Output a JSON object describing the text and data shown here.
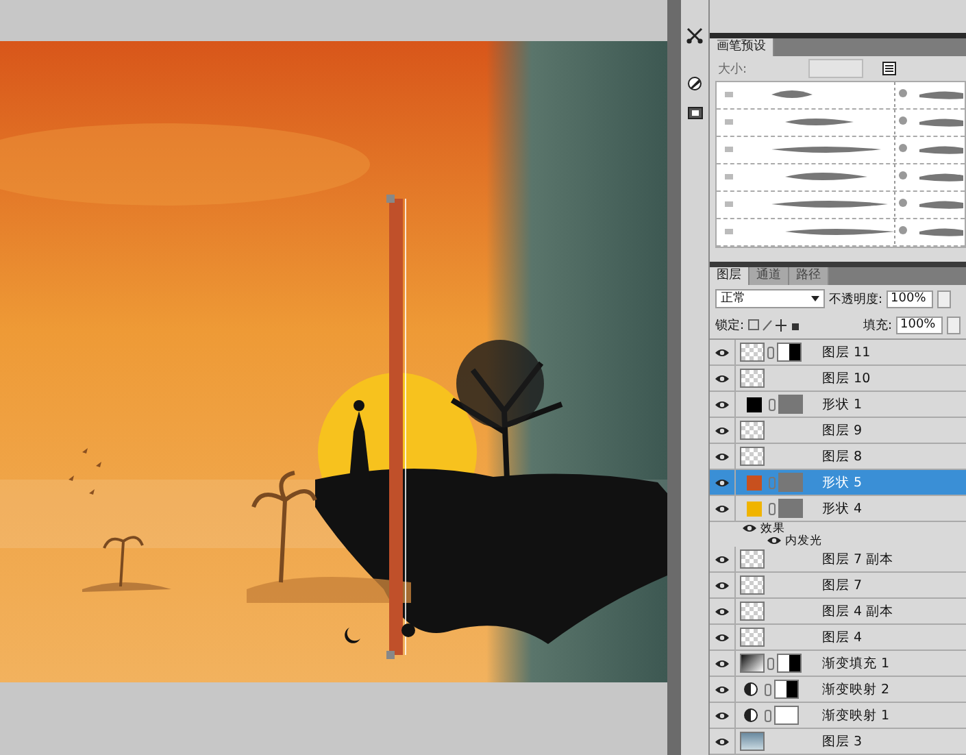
{
  "brush_panel": {
    "tabs": [
      {
        "label": "画笔预设",
        "selected": true
      }
    ],
    "size_label": "大小:"
  },
  "layers_panel": {
    "tabs": [
      {
        "label": "图层",
        "selected": true
      },
      {
        "label": "通道",
        "selected": false
      },
      {
        "label": "路径",
        "selected": false
      }
    ],
    "blend_mode": "正常",
    "opacity_label": "不透明度:",
    "opacity": "100%",
    "lock_label": "锁定:",
    "fill_label": "填充:",
    "fill": "100%",
    "layers": [
      {
        "kind": "layer",
        "name": "图层 11",
        "selected": false,
        "mask": true,
        "mask_has_black": true
      },
      {
        "kind": "layer",
        "name": "图层 10",
        "selected": false
      },
      {
        "kind": "shape",
        "name": "形状 1",
        "selected": false,
        "color": "#000000"
      },
      {
        "kind": "layer",
        "name": "图层 9",
        "selected": false
      },
      {
        "kind": "layer",
        "name": "图层 8",
        "selected": false
      },
      {
        "kind": "shape",
        "name": "形状 5",
        "selected": true,
        "color": "#c8501e"
      },
      {
        "kind": "shape",
        "name": "形状 4",
        "selected": false,
        "color": "#f0b400"
      },
      {
        "kind": "effects",
        "name": "效果",
        "selected": false
      },
      {
        "kind": "effect",
        "name": "内发光",
        "selected": false
      },
      {
        "kind": "layer",
        "name": "图层 7 副本",
        "selected": false
      },
      {
        "kind": "layer",
        "name": "图层 7",
        "selected": false
      },
      {
        "kind": "layer",
        "name": "图层 4 副本",
        "selected": false
      },
      {
        "kind": "layer",
        "name": "图层 4",
        "selected": false
      },
      {
        "kind": "fill",
        "name": "渐变填充 1",
        "selected": false,
        "mask": true,
        "mask_has_black": true
      },
      {
        "kind": "adjustment",
        "name": "渐变映射 2",
        "selected": false,
        "mask": true,
        "mask_has_black": true
      },
      {
        "kind": "adjustment",
        "name": "渐变映射 1",
        "selected": false,
        "mask": true,
        "mask_has_black": false
      },
      {
        "kind": "image",
        "name": "图层 3",
        "selected": false
      }
    ]
  }
}
